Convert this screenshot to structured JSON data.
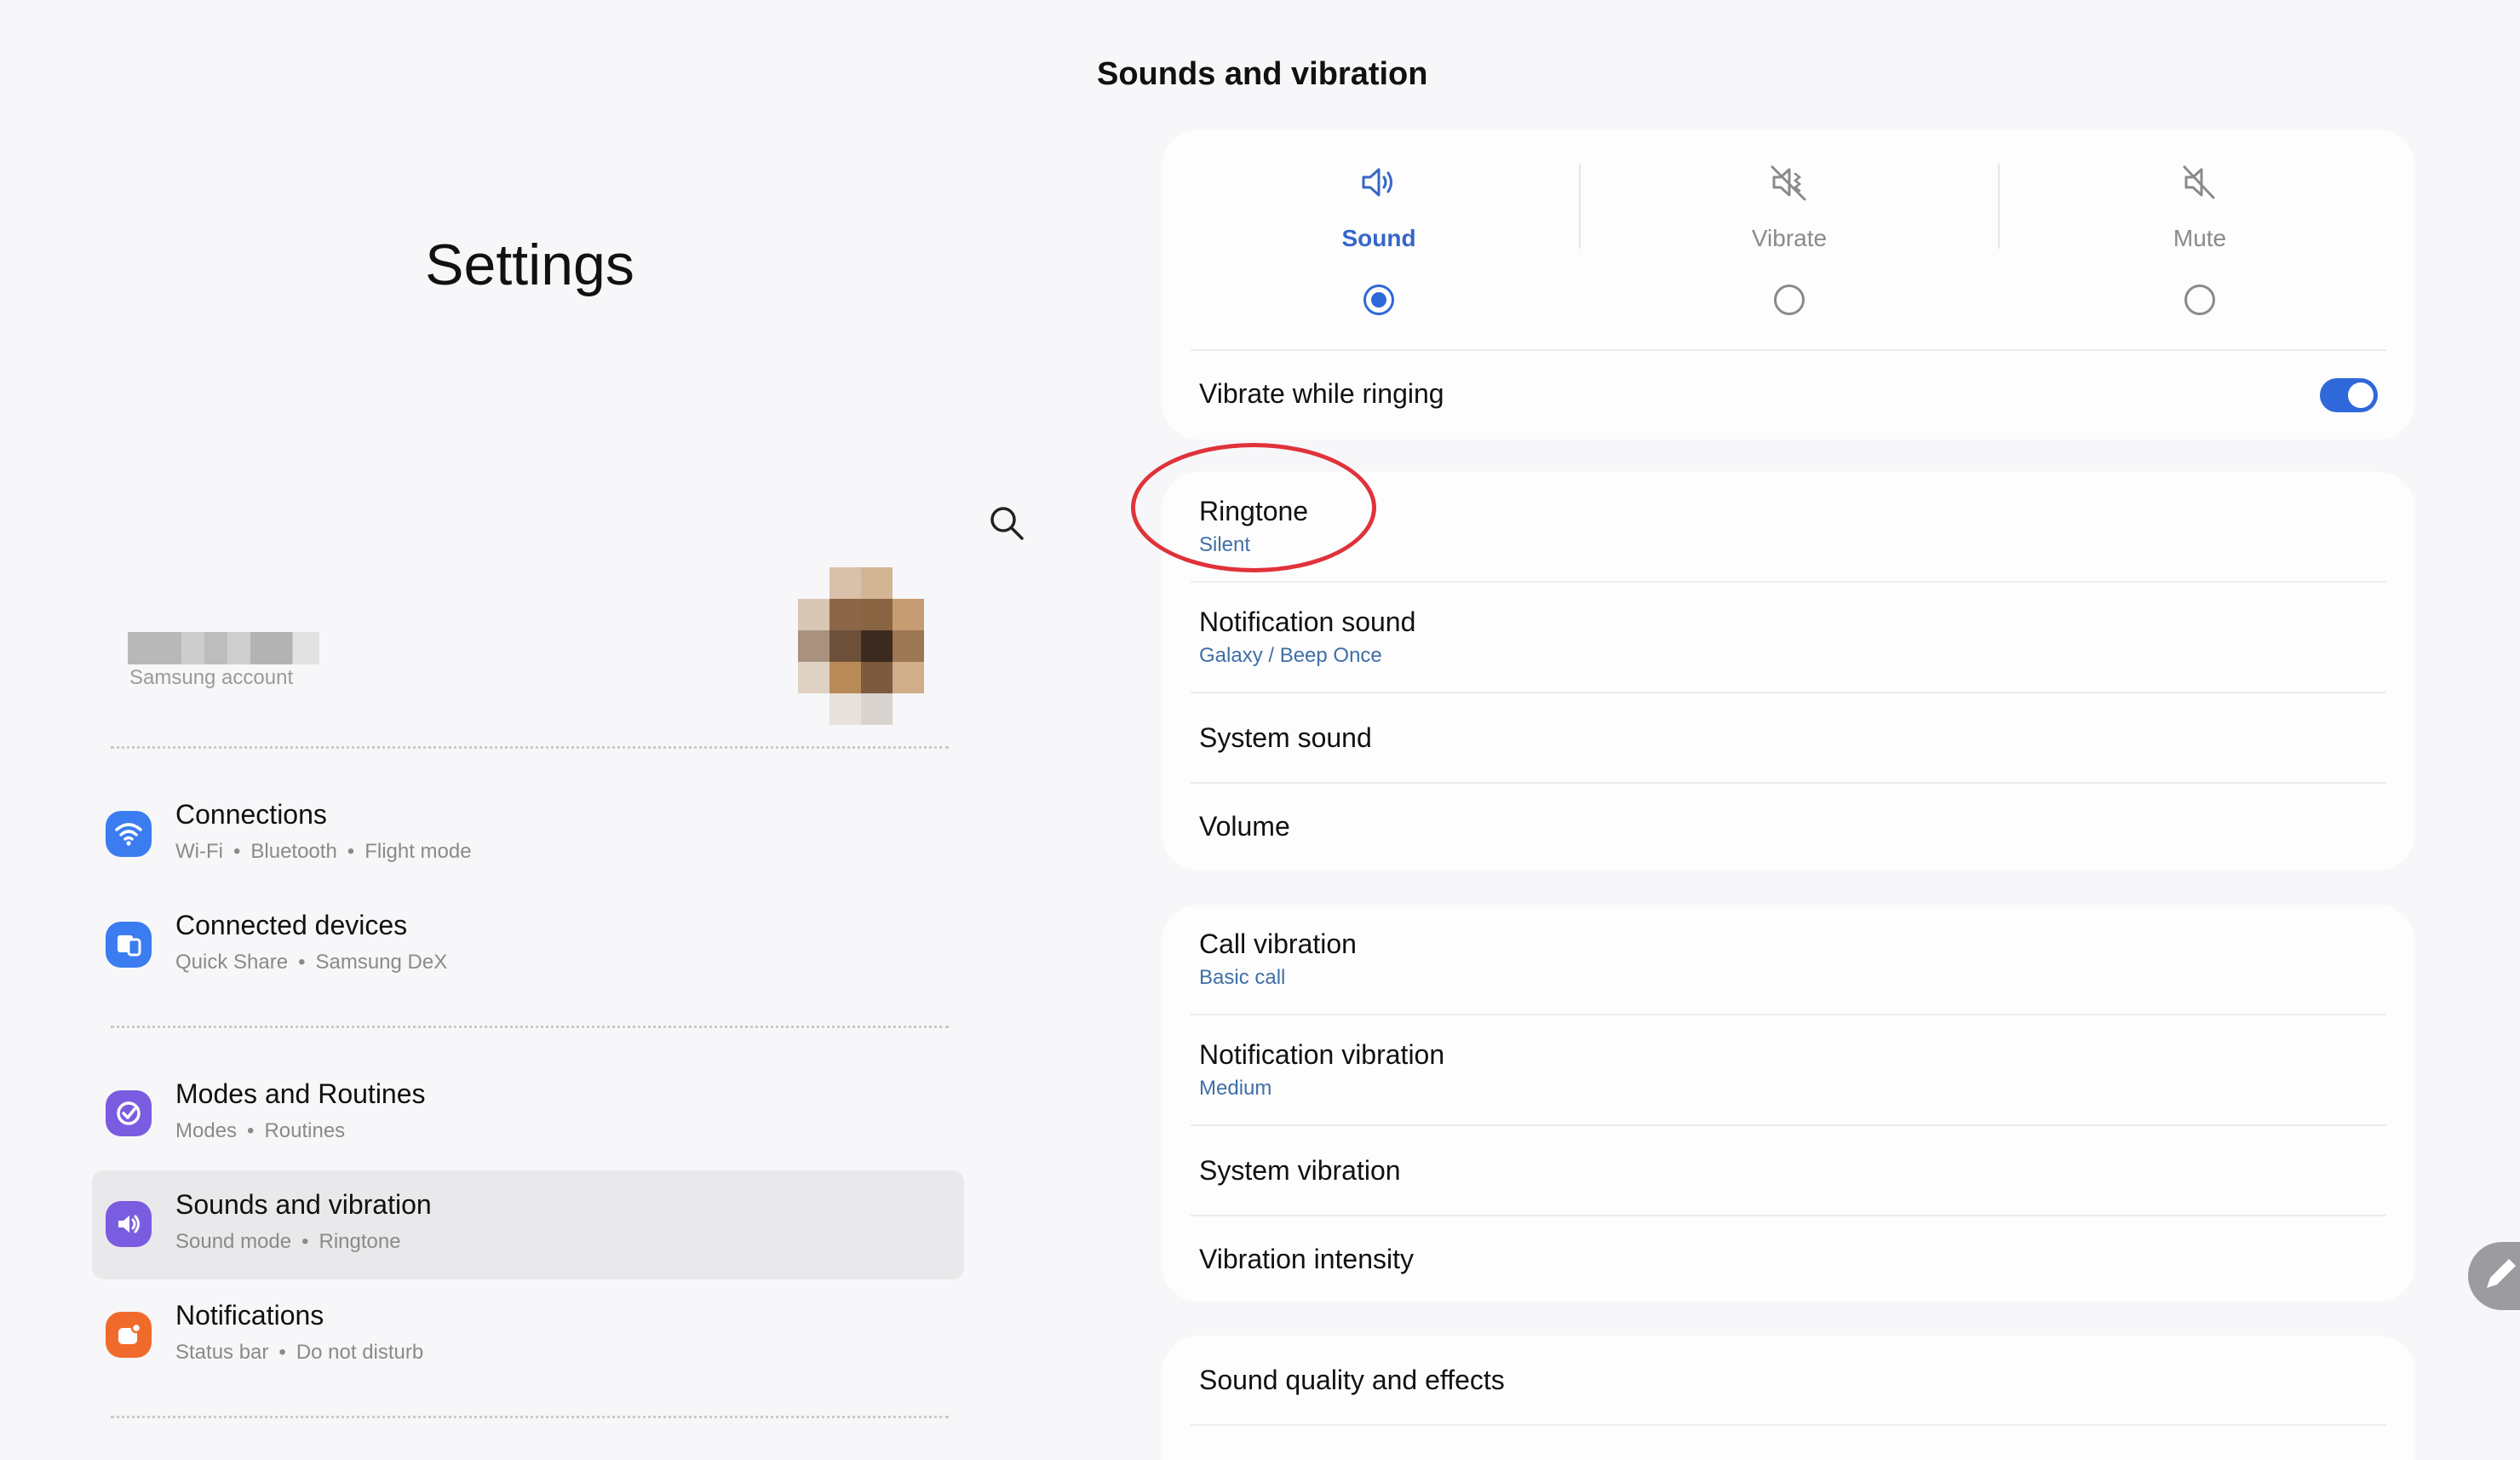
{
  "left": {
    "title": "Settings",
    "account": {
      "subtitle": "Samsung account"
    },
    "items": [
      {
        "title": "Connections",
        "subs": [
          "Wi-Fi",
          "Bluetooth",
          "Flight mode"
        ],
        "icon": "wifi-icon",
        "color": "#3b7cf0"
      },
      {
        "title": "Connected devices",
        "subs": [
          "Quick Share",
          "Samsung DeX"
        ],
        "icon": "devices-icon",
        "color": "#3b7cf0"
      },
      {
        "title": "Modes and Routines",
        "subs": [
          "Modes",
          "Routines"
        ],
        "icon": "check-circle-icon",
        "color": "#7a5ce0"
      },
      {
        "title": "Sounds and vibration",
        "subs": [
          "Sound mode",
          "Ringtone"
        ],
        "icon": "speaker-icon",
        "color": "#7a5ce0"
      },
      {
        "title": "Notifications",
        "subs": [
          "Status bar",
          "Do not disturb"
        ],
        "icon": "notification-icon",
        "color": "#f06b2b"
      }
    ]
  },
  "right": {
    "title": "Sounds and vibration",
    "modes": [
      {
        "label": "Sound",
        "selected": true,
        "icon": "speaker-icon"
      },
      {
        "label": "Vibrate",
        "selected": false,
        "icon": "vibrate-icon"
      },
      {
        "label": "Mute",
        "selected": false,
        "icon": "mute-icon"
      }
    ],
    "vibrate_while_ringing": {
      "label": "Vibrate while ringing",
      "on": true
    },
    "sound_rows": [
      {
        "title": "Ringtone",
        "sub": "Silent"
      },
      {
        "title": "Notification sound",
        "sub": "Galaxy / Beep Once"
      },
      {
        "title": "System sound",
        "sub": ""
      },
      {
        "title": "Volume",
        "sub": ""
      }
    ],
    "vibration_rows": [
      {
        "title": "Call vibration",
        "sub": "Basic call"
      },
      {
        "title": "Notification vibration",
        "sub": "Medium"
      },
      {
        "title": "System vibration",
        "sub": ""
      },
      {
        "title": "Vibration intensity",
        "sub": ""
      }
    ],
    "more_rows": [
      {
        "title": "Sound quality and effects"
      }
    ]
  },
  "colors": {
    "accent": "#2f68d8",
    "subtext_blue": "#3f6fa8",
    "highlight": "#e0323a"
  }
}
